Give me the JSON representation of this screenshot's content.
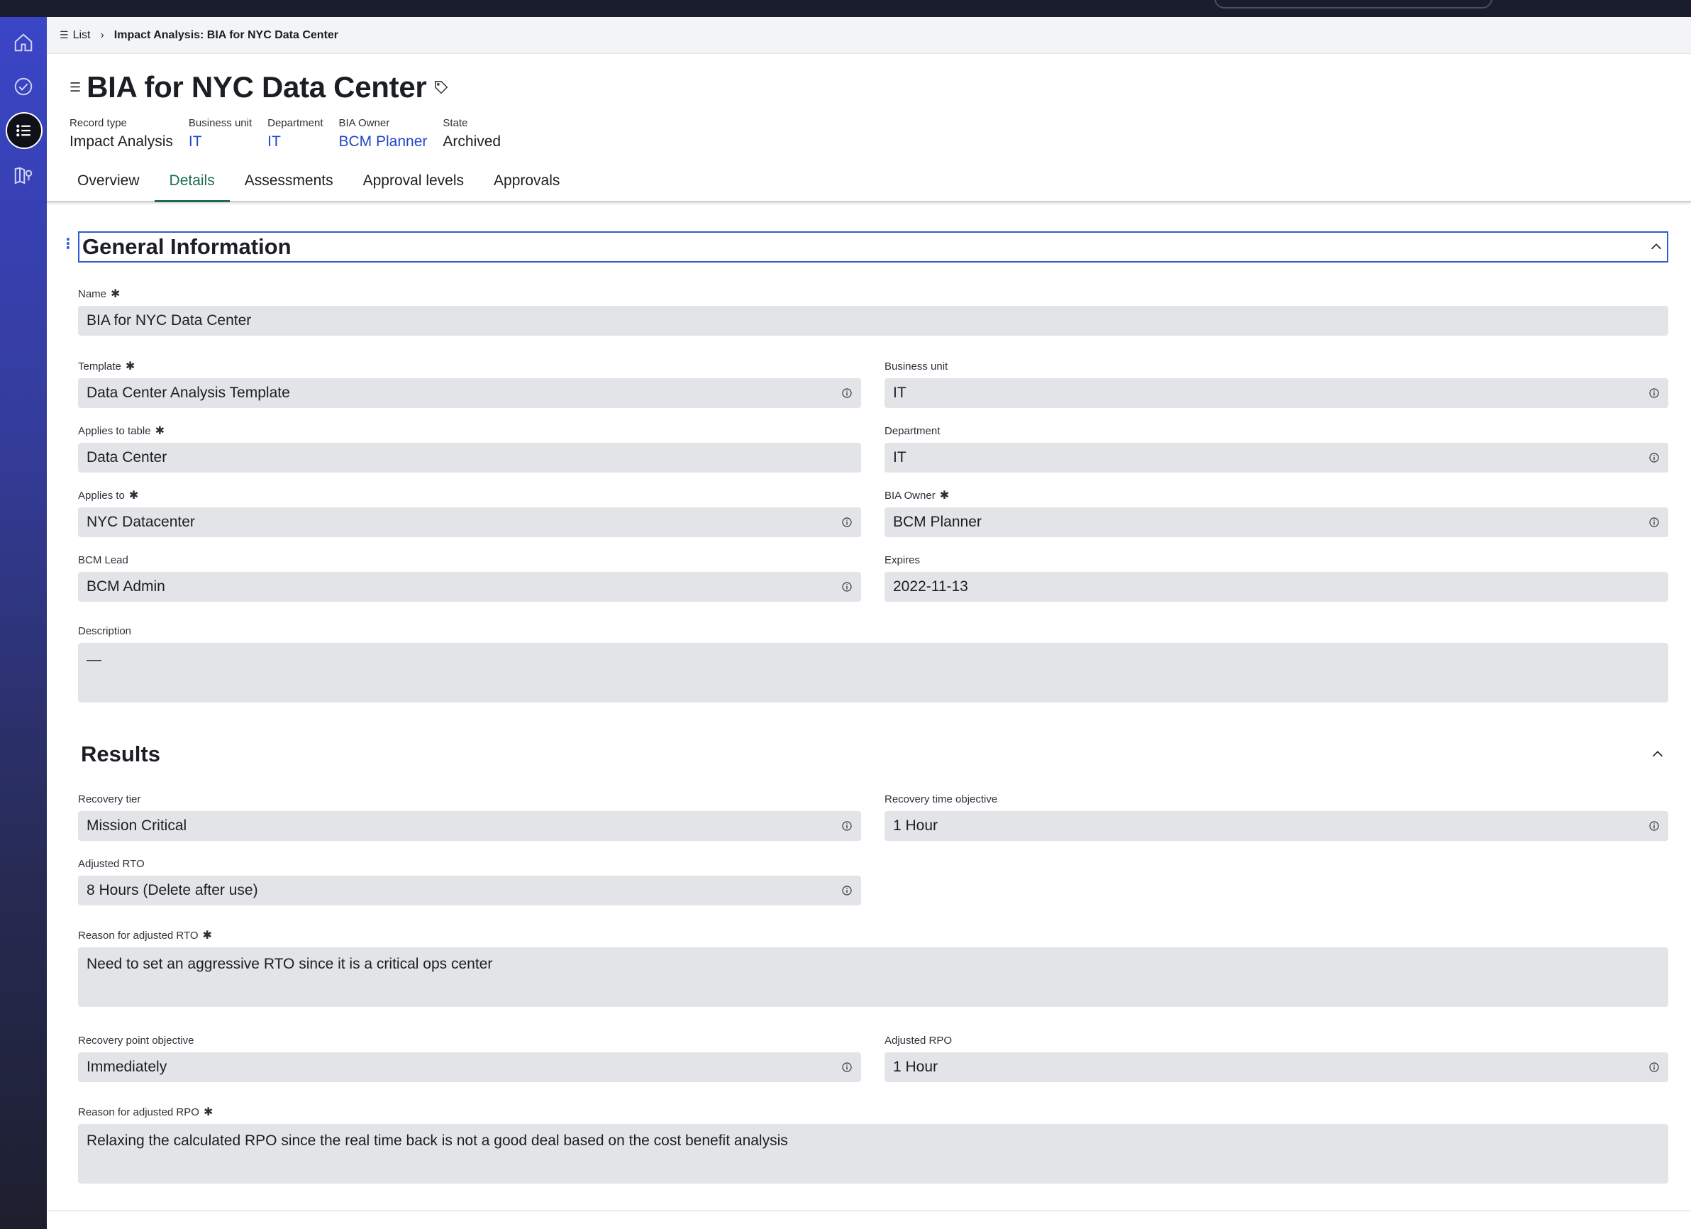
{
  "breadcrumb": {
    "list_label": "List",
    "current": "Impact Analysis: BIA for NYC Data Center"
  },
  "record": {
    "title": "BIA for NYC Data Center",
    "meta": [
      {
        "label": "Record type",
        "value": "Impact Analysis"
      },
      {
        "label": "Business unit",
        "value": "IT"
      },
      {
        "label": "Department",
        "value": "IT"
      },
      {
        "label": "BIA Owner",
        "value": "BCM Planner"
      },
      {
        "label": "State",
        "value": "Archived"
      }
    ]
  },
  "tabs": [
    "Overview",
    "Details",
    "Assessments",
    "Approval levels",
    "Approvals"
  ],
  "active_tab": "Details",
  "general": {
    "heading": "General Information",
    "name": {
      "label": "Name",
      "value": "BIA for NYC Data Center"
    },
    "template": {
      "label": "Template",
      "value": "Data Center Analysis Template"
    },
    "business_unit": {
      "label": "Business unit",
      "value": "IT"
    },
    "applies_to_table": {
      "label": "Applies to table",
      "value": "Data Center"
    },
    "department": {
      "label": "Department",
      "value": "IT"
    },
    "applies_to": {
      "label": "Applies to",
      "value": "NYC Datacenter"
    },
    "bia_owner": {
      "label": "BIA Owner",
      "value": "BCM Planner"
    },
    "bcm_lead": {
      "label": "BCM Lead",
      "value": "BCM Admin"
    },
    "expires": {
      "label": "Expires",
      "value": "2022-11-13"
    },
    "description": {
      "label": "Description",
      "value": "—"
    }
  },
  "results": {
    "heading": "Results",
    "recovery_tier": {
      "label": "Recovery tier",
      "value": "Mission Critical"
    },
    "rto": {
      "label": "Recovery time objective",
      "value": "1 Hour"
    },
    "adjusted_rto": {
      "label": "Adjusted RTO",
      "value": "8 Hours (Delete after use)"
    },
    "reason_rto": {
      "label": "Reason for adjusted RTO",
      "value": "Need to set an aggressive RTO since it is a critical ops center"
    },
    "rpo": {
      "label": "Recovery point objective",
      "value": "Immediately"
    },
    "adjusted_rpo": {
      "label": "Adjusted RPO",
      "value": "1 Hour"
    },
    "reason_rpo": {
      "label": "Reason for adjusted RPO",
      "value": "Relaxing the calculated RPO since the real time back is not a good deal based on the cost benefit analysis"
    }
  },
  "required_marker": "✱",
  "colors": {
    "accent_blue": "#2e5bd1",
    "link": "#2047c7",
    "active_tab": "#1a6b52",
    "field_bg": "#e3e4e8"
  }
}
